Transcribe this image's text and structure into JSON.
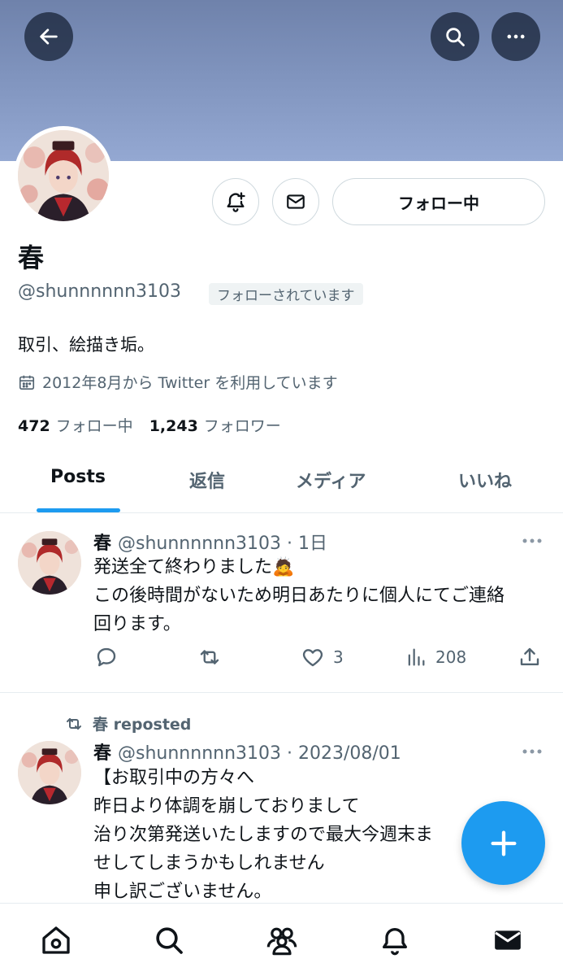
{
  "header": {
    "back_icon": "arrow-left-icon",
    "search_icon": "search-icon",
    "more_icon": "more-horizontal-icon"
  },
  "profile": {
    "name": "春",
    "handle": "@shunnnnnn3103",
    "follows_you": "フォローされています",
    "bio": "取引、絵描き垢。",
    "joined": "2012年8月から Twitter を利用しています",
    "following_count": "472",
    "following_label": "フォロー中",
    "followers_count": "1,243",
    "followers_label": "フォロワー",
    "follow_button": "フォロー中"
  },
  "tabs": [
    {
      "label": "Posts",
      "active": true
    },
    {
      "label": "返信",
      "active": false
    },
    {
      "label": "メディア",
      "active": false
    },
    {
      "label": "いいね",
      "active": false
    }
  ],
  "tweets": [
    {
      "name": "春",
      "meta": "@shunnnnnn3103 · 1日",
      "lines": [
        "発送全て終わりました🙇",
        "この後時間がないため明日あたりに個人にてご連絡",
        "回ります。"
      ],
      "likes": "3",
      "views": "208"
    },
    {
      "reposted_by": "春 reposted",
      "name": "春",
      "meta": "@shunnnnnn3103 · 2023/08/01",
      "lines": [
        "【お取引中の方々へ",
        "昨日より体調を崩しておりまして",
        "治り次第発送いたしますので最大今週末ま",
        "せしてしまうかもしれません",
        "申し訳ございません。"
      ]
    }
  ],
  "bottom_nav": [
    "home-icon",
    "search-icon",
    "communities-icon",
    "notifications-icon",
    "messages-icon"
  ],
  "colors": {
    "accent": "#1d9bf0",
    "banner": "#8397c2",
    "text_secondary": "#536471"
  }
}
